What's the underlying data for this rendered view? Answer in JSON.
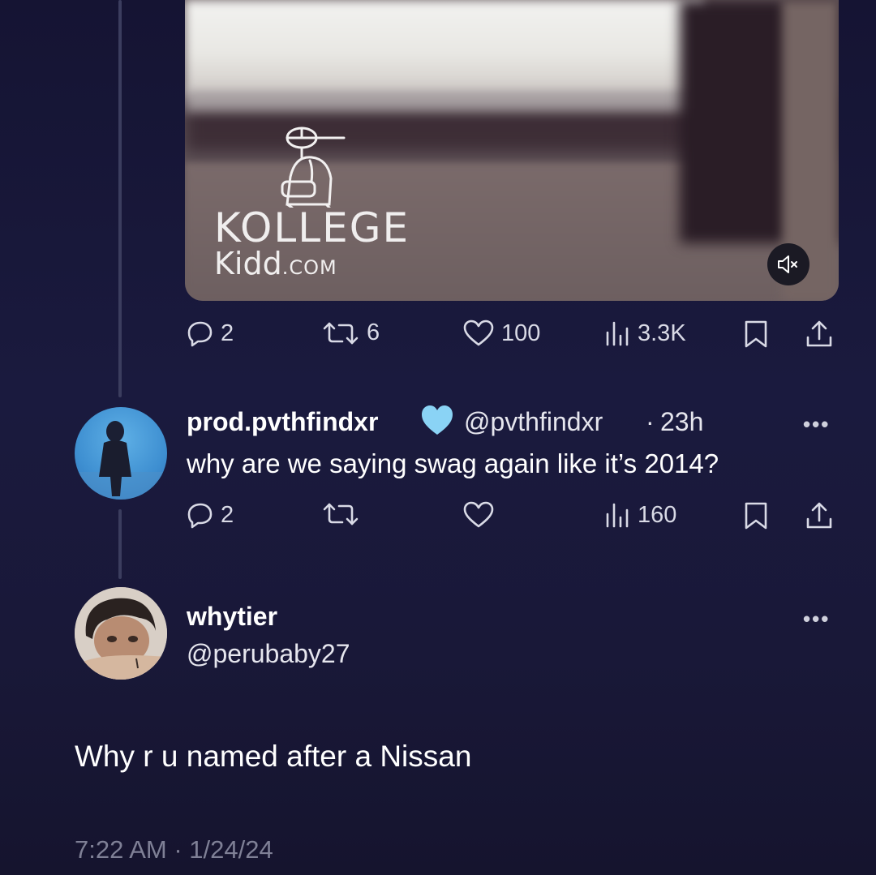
{
  "video": {
    "logo_top": "KOLLEGE",
    "logo_bottom": "Kidd",
    "logo_suffix": ".COM",
    "mute_icon": "mute-icon"
  },
  "main_post_actions": {
    "replies": "2",
    "reposts": "6",
    "likes": "100",
    "views": "3.3K"
  },
  "reply1": {
    "display_name": "prod.pvthfindxr",
    "verified_badge": "heart-badge-icon",
    "handle": "@pvthfindxr",
    "separator": "·",
    "time": "23h",
    "more": "•••",
    "text": "why are we saying swag again like it’s 2014?",
    "actions": {
      "replies": "2",
      "reposts": "",
      "likes": "",
      "views": "160"
    }
  },
  "reply2": {
    "display_name": "whytier",
    "handle": "@perubaby27",
    "more": "•••",
    "text": "Why r u named after a Nissan",
    "timestamp": "7:22 AM · 1/24/24"
  },
  "colors": {
    "background": "#19183a",
    "text": "#ffffff",
    "muted": "#7f8096",
    "badge": "#8ad3f5"
  }
}
